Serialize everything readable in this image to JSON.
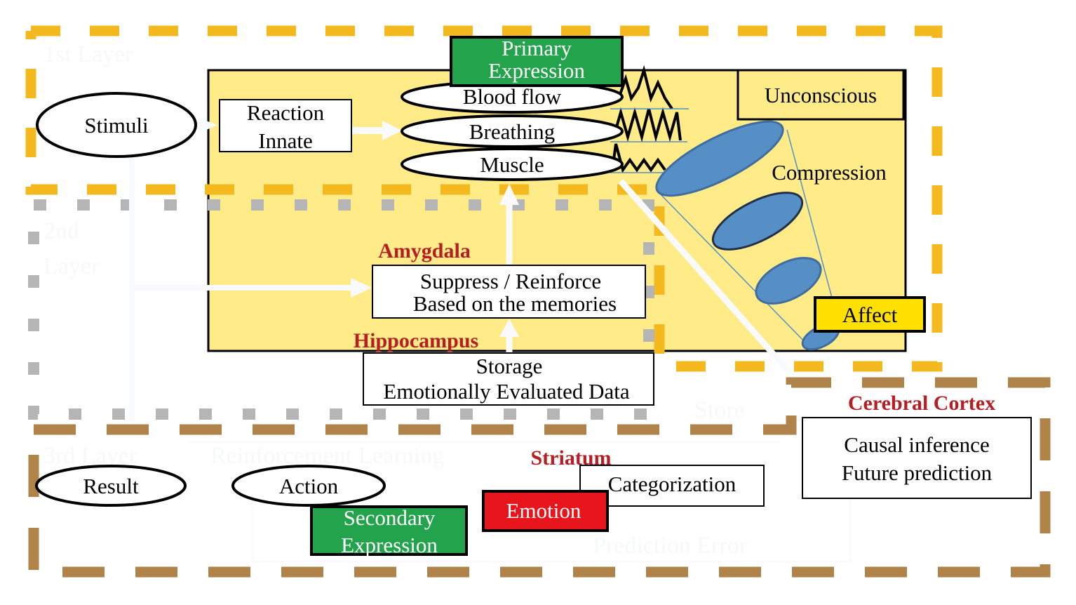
{
  "colors": {
    "layer1": "#F3B91E",
    "layer2": "#B5B5B5",
    "layer3": "#B0834A",
    "panel": "#FFEB88",
    "green": "#23A34B",
    "red": "#E8161C",
    "affect": "#FFE000",
    "blue": "#568FC6",
    "label_red": "#B51F24"
  },
  "layers": {
    "first": "1st Layer",
    "second_line1": "2nd",
    "second_line2": "Layer",
    "third": "3rd Layer"
  },
  "nodes": {
    "stimuli": "Stimuli",
    "reaction_line1": "Reaction",
    "reaction_line2": "Innate",
    "primary_line1": "Primary",
    "primary_line2": "Expression",
    "blood_flow": "Blood flow",
    "breathing": "Breathing",
    "muscle": "Muscle",
    "unconscious": "Unconscious",
    "compression": "Compression",
    "affect": "Affect",
    "amygdala": "Amygdala",
    "suppress_line1": "Suppress / Reinforce",
    "suppress_line2": "Based on the memories",
    "hippocampus": "Hippocampus",
    "storage_line1": "Storage",
    "storage_line2": "Emotionally Evaluated Data",
    "store": "Store",
    "cerebral_cortex": "Cerebral Cortex",
    "causal_line1": "Causal inference",
    "causal_line2": "Future prediction",
    "striatum": "Striatum",
    "categorization": "Categorization",
    "emotion": "Emotion",
    "result": "Result",
    "action": "Action",
    "secondary_line1": "Secondary",
    "secondary_line2": "Expression",
    "reinforcement_learning": "Reinforcement Learning",
    "prediction_error": "Prediction Error"
  }
}
